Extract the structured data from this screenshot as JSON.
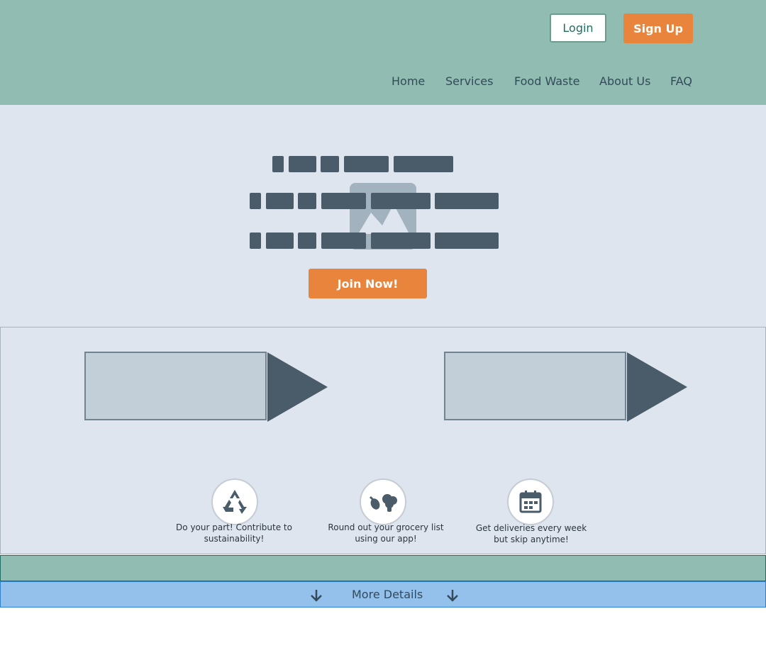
{
  "header": {
    "login_label": "Login",
    "signup_label": "Sign Up",
    "nav": [
      "Home",
      "Services",
      "Food Waste",
      "About Us",
      "FAQ"
    ]
  },
  "hero": {
    "join_label": "Join Now!"
  },
  "features": {
    "items": [
      {
        "icon": "recycle-icon",
        "text": "Do your part! Contribute to sustainability!"
      },
      {
        "icon": "vegetables-icon",
        "text": "Round out your grocery list using our app!"
      },
      {
        "icon": "calendar-icon",
        "text": "Get deliveries every week but skip anytime!"
      }
    ]
  },
  "footer": {
    "more_label": "More Details"
  },
  "colors": {
    "header_bg": "#90bcb2",
    "accent": "#e8843b",
    "hero_bg": "#dfe5ee",
    "dark": "#4a5b69",
    "link_bar": "#93c1ec"
  }
}
